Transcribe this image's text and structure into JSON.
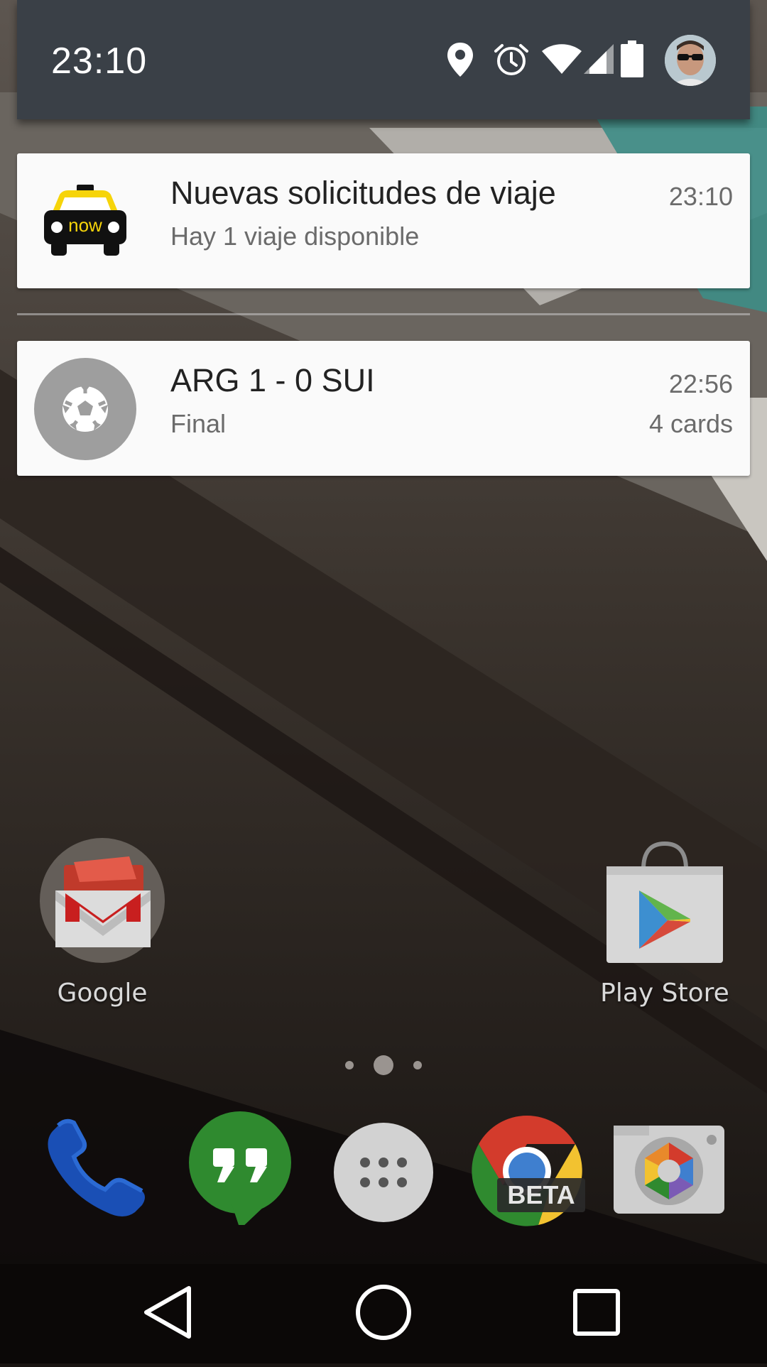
{
  "status_bar": {
    "time": "23:10",
    "icons": [
      "location-icon",
      "alarm-icon",
      "wifi-icon",
      "signal-icon",
      "battery-icon"
    ],
    "profile": "user-avatar"
  },
  "notifications": [
    {
      "app_icon": "taxi-now-icon",
      "icon_text": "now",
      "title": "Nuevas solicitudes de viaje",
      "text": "Hay 1 viaje disponible",
      "time": "23:10"
    },
    {
      "app_icon": "soccer-ball-icon",
      "title": "ARG 1 - 0 SUI",
      "text": "Final",
      "time": "22:56",
      "info": "4 cards"
    }
  ],
  "home": {
    "shortcuts": [
      {
        "icon": "gmail-icon",
        "label": "Google"
      },
      {
        "icon": "play-store-icon",
        "label": "Play Store"
      }
    ],
    "page_indicator": {
      "pages": 3,
      "current": 2
    },
    "dock": [
      {
        "icon": "phone-icon"
      },
      {
        "icon": "hangouts-icon"
      },
      {
        "icon": "app-drawer-icon"
      },
      {
        "icon": "chrome-beta-icon",
        "badge": "BETA"
      },
      {
        "icon": "camera-icon"
      }
    ]
  },
  "nav_bar": [
    "back-icon",
    "home-icon",
    "recents-icon"
  ],
  "colors": {
    "header": "#3a4047",
    "card": "#fafafa",
    "taxi_yellow": "#f6d40a",
    "ball_circle": "#9e9e9e"
  }
}
